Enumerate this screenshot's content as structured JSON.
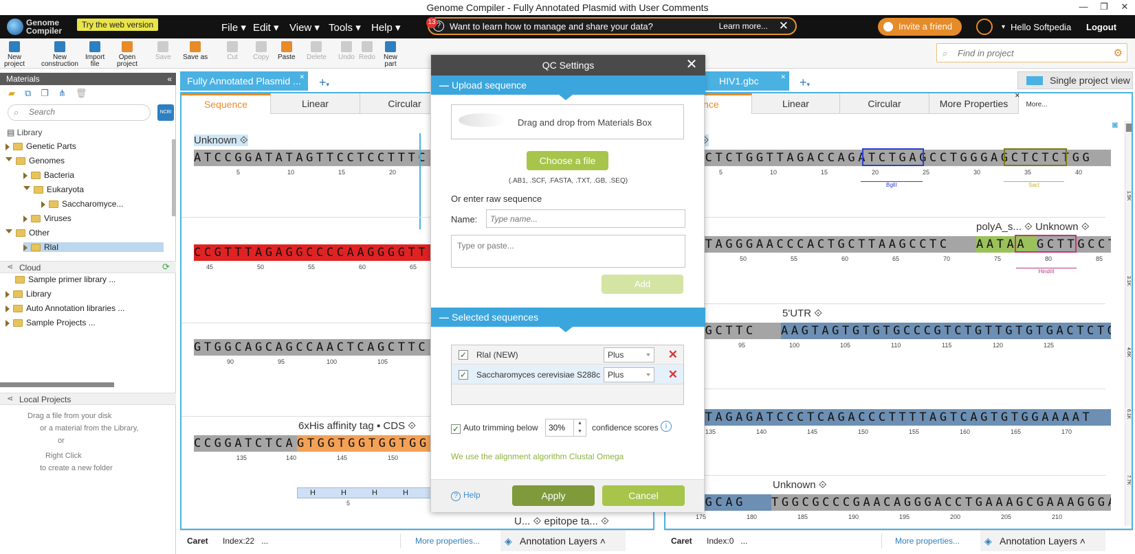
{
  "window": {
    "title": "Genome Compiler - Fully Annotated Plasmid with User Comments",
    "controls": [
      "—",
      "❐",
      "✕"
    ]
  },
  "topbar": {
    "logo_line1": "Genome",
    "logo_line2": "Compiler",
    "try_web": "Try the web version",
    "menus": [
      "File",
      "Edit",
      "View",
      "Tools",
      "Help"
    ],
    "notification_count": "13",
    "info_message": "Want to learn how to manage and share your data?",
    "learn_more": "Learn more...",
    "invite": "Invite a friend",
    "hello": "Hello Softpedia",
    "logout": "Logout"
  },
  "toolbar": {
    "buttons": [
      {
        "label1": "New",
        "label2": "project",
        "color": "#2e7fbf"
      },
      {
        "label1": "New",
        "label2": "construction",
        "color": "#2e7fbf"
      },
      {
        "label1": "Import",
        "label2": "file",
        "color": "#2e7fbf"
      },
      {
        "label1": "Open",
        "label2": "project",
        "color": "#e68b2a"
      },
      {
        "label1": "Save",
        "label2": "",
        "color": "#999999"
      },
      {
        "label1": "Save as",
        "label2": "",
        "color": "#e68b2a"
      },
      {
        "label1": "Cut",
        "label2": "",
        "color": "#999999"
      },
      {
        "label1": "Copy",
        "label2": "",
        "color": "#999999"
      },
      {
        "label1": "Paste",
        "label2": "",
        "color": "#e68b2a"
      },
      {
        "label1": "Delete",
        "label2": "",
        "color": "#999999"
      },
      {
        "label1": "Undo",
        "label2": "",
        "color": "#999999"
      },
      {
        "label1": "Redo",
        "label2": "",
        "color": "#999999"
      },
      {
        "label1": "New",
        "label2": "part",
        "color": "#2e7fbf"
      }
    ],
    "find_placeholder": "Find in project"
  },
  "materials": {
    "title": "Materials",
    "search_placeholder": "Search",
    "ncbi": "NCBI",
    "library_header": "Library",
    "library_items": [
      {
        "label": "Genetic Parts",
        "indent": 0,
        "open": false
      },
      {
        "label": "Genomes",
        "indent": 0,
        "open": true
      },
      {
        "label": "Bacteria",
        "indent": 1,
        "open": false
      },
      {
        "label": "Eukaryota",
        "indent": 1,
        "open": true
      },
      {
        "label": "Saccharomyce...",
        "indent": 2,
        "open": false
      },
      {
        "label": "Viruses",
        "indent": 1,
        "open": false
      },
      {
        "label": "Other",
        "indent": 0,
        "open": true
      },
      {
        "label": "RlaI",
        "indent": 1,
        "open": false
      }
    ],
    "cloud_header": "Cloud",
    "cloud_items": [
      "Sample primer library ...",
      "Library",
      "Auto Annotation libraries ...",
      "Sample Projects ..."
    ],
    "local_header": "Local Projects",
    "local_hint": [
      "Drag a file from your disk",
      "or a material from the Library,",
      "or",
      "Right Click",
      "to create a new folder"
    ]
  },
  "left_editor": {
    "tab": "Fully Annotated Plasmid ...",
    "view_tabs": [
      "Sequence",
      "Linear",
      "Circular"
    ],
    "rows": [
      {
        "label": "Unknown ⟐",
        "seq": "ATCCGGATATAGTTCCTCCTTTC",
        "ticks": [
          "5",
          "10",
          "15",
          "20"
        ],
        "color": "gray"
      },
      {
        "label": "",
        "seq": "CCGTTTAGAGGCCCCAAGGGGTT",
        "ticks": [
          "45",
          "50",
          "55",
          "60",
          "65"
        ],
        "color": "red"
      },
      {
        "label": "",
        "seq": "GTGGCAGCAGCCAACTCAGCTTC",
        "ticks": [
          "90",
          "95",
          "100",
          "105"
        ],
        "color": "gray"
      },
      {
        "label": "6xHis affinity tag ▪ CDS ⟐",
        "seq": "CCGGATCTCA",
        "seq2": "GTGGTGGTGGTGG",
        "ticks": [
          "135",
          "140",
          "145",
          "150"
        ],
        "color": "gray"
      }
    ],
    "his_tags": [
      "H",
      "H",
      "H",
      "H"
    ],
    "his_index": "5",
    "bottom_label": "U... ⟐ epitope ta...  ⟐",
    "footer": {
      "caret": "Caret",
      "index": "Index:22",
      "dots": "...",
      "more": "More properties...",
      "layers": "Annotation Layers"
    }
  },
  "right_editor": {
    "tab": "HIV1.gbc",
    "view_tabs": [
      "ence",
      "Linear",
      "Circular",
      "More Properties"
    ],
    "more": "More...",
    "single_view": "Single project view",
    "rows": [
      {
        "label": "wn ⟐",
        "seq": "CTCTCTGGTTAGACCAGATCTGAGCCTGGGAGCTCTCTGG",
        "ticks": [
          "5",
          "10",
          "15",
          "20",
          "25",
          "30",
          "35",
          "40"
        ],
        "enz": [
          "BglII",
          "SacI"
        ]
      },
      {
        "label": "polyA_s... ⟐ Unknown ⟐",
        "seq": "ACTAGGGAACCCACTGCTTAAGCCTC",
        "seq2": "AATAAAGCTTGCCT",
        "ticks": [
          "50",
          "55",
          "60",
          "65",
          "70",
          "75",
          "80",
          "85"
        ],
        "enz": [
          "HindIII"
        ]
      },
      {
        "label": "5'UTR ⟐",
        "seq": "GTGCTTC",
        "seq2": "AAGTAGTGTGTGCCCGTCTGTTGTGTGACTCTG",
        "ticks": [
          "90",
          "95",
          "100",
          "105",
          "110",
          "115",
          "120",
          "125"
        ]
      },
      {
        "label": "",
        "seq": "ACTAGAGATCCCTCAGACCCTTTTAGTCAGTGTGGAAAAT",
        "ticks": [
          "135",
          "140",
          "145",
          "150",
          "155",
          "160",
          "165",
          "170"
        ]
      },
      {
        "label": "Unknown ⟐",
        "seq": "TAGCAG",
        "seq2": "TGGCGCCCGAACAGGGACCTGAAAGCGAAAGGGA",
        "ticks": [
          "175",
          "180",
          "185",
          "190",
          "195",
          "200",
          "205",
          "210"
        ]
      }
    ],
    "ruler": [
      "1.5K",
      "3.1K",
      "4.6K",
      "6.1K",
      "7.7K"
    ],
    "footer": {
      "caret": "Caret",
      "index": "Index:0",
      "dots": "...",
      "more": "More properties...",
      "layers": "Annotation Layers"
    }
  },
  "qc_dialog": {
    "title": "QC Settings",
    "upload_section": "Upload sequence",
    "drop_text": "Drag and drop from Materials Box",
    "choose_file": "Choose a file",
    "formats": "(.AB1, .SCF, .FASTA, .TXT, .GB, .SEQ)",
    "raw_label": "Or enter raw sequence",
    "name_label": "Name:",
    "name_placeholder": "Type name...",
    "raw_placeholder": "Type or paste...",
    "add": "Add",
    "selected_section": "Selected sequences",
    "selected": [
      {
        "name": "RlaI (NEW)",
        "strand": "Plus"
      },
      {
        "name": "Saccharomyces cerevisiae S288c ...",
        "strand": "Plus"
      }
    ],
    "auto_trim": "Auto trimming below",
    "trim_value": "30%",
    "confidence": "confidence scores",
    "algo_note": "We use the alignment algorithm Clustal Omega",
    "help": "Help",
    "apply": "Apply",
    "cancel": "Cancel"
  }
}
